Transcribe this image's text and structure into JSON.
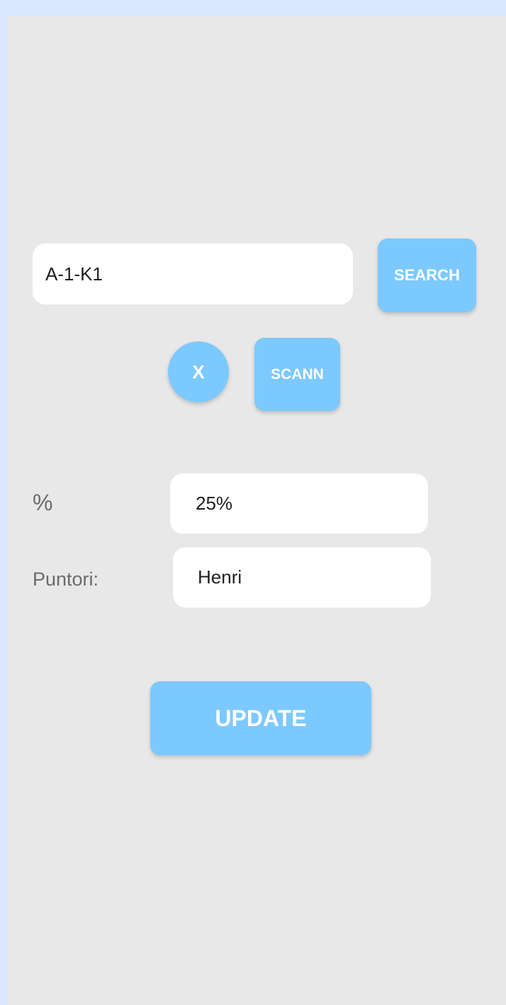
{
  "search": {
    "value": "A-1-K1",
    "button_label": "SEARCH"
  },
  "actions": {
    "clear_label": "X",
    "scan_label": "SCANN"
  },
  "form": {
    "percent_label": "%",
    "percent_value": "25%",
    "worker_label": "Puntori:",
    "worker_value": "Henri"
  },
  "update": {
    "button_label": "UPDATE"
  },
  "colors": {
    "accent": "#7cc9ff",
    "screen_bg": "#e8e8e8",
    "frame_bg": "#dbe6ff"
  }
}
